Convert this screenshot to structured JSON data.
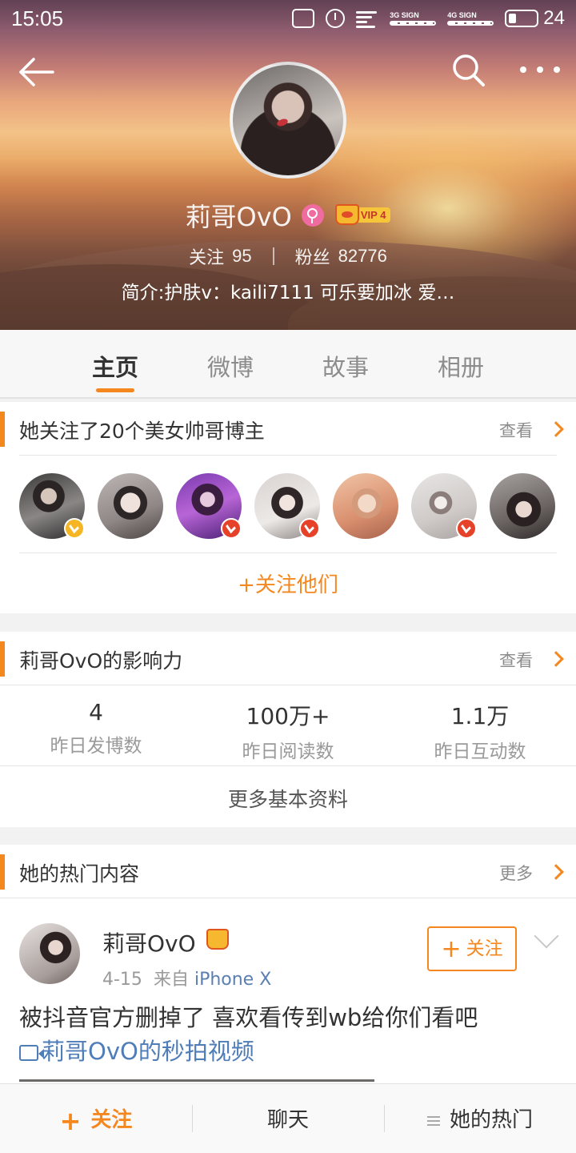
{
  "status_bar": {
    "time": "15:05",
    "network_1": "3G SIGN",
    "network_2": "4G SIGN",
    "battery": "24"
  },
  "profile": {
    "name": "莉哥OvO",
    "vip_level": "VIP 4",
    "following_label": "关注",
    "following_count": "95",
    "fans_label": "粉丝",
    "fans_count": "82776",
    "bio": "简介:护肤v：kaili7111  可乐要加冰  爱…"
  },
  "tabs": [
    {
      "label": "主页",
      "active": true
    },
    {
      "label": "微博",
      "active": false
    },
    {
      "label": "故事",
      "active": false
    },
    {
      "label": "相册",
      "active": false
    }
  ],
  "follows_card": {
    "title": "她关注了20个美女帅哥博主",
    "link": "查看",
    "action": "+关注他们",
    "avatars": [
      {
        "verified": "gold"
      },
      {
        "verified": "none"
      },
      {
        "verified": "red"
      },
      {
        "verified": "red"
      },
      {
        "verified": "none"
      },
      {
        "verified": "red"
      },
      {
        "verified": "none"
      }
    ]
  },
  "influence_card": {
    "title": "莉哥OvO的影响力",
    "link": "查看",
    "stats": [
      {
        "value": "4",
        "label": "昨日发博数"
      },
      {
        "value": "100万+",
        "label": "昨日阅读数"
      },
      {
        "value": "1.1万",
        "label": "昨日互动数"
      }
    ],
    "more": "更多基本资料"
  },
  "hot_card": {
    "title": "她的热门内容",
    "link": "更多",
    "post": {
      "author": "莉哥OvO",
      "date": "4-15",
      "from_label": "来自",
      "source": "iPhone X",
      "follow_label": "关注",
      "text": "被抖音官方删掉了  喜欢看传到wb给你们看吧",
      "video_link": "莉哥OvO的秒拍视频"
    }
  },
  "bottom_bar": {
    "follow": "关注",
    "chat": "聊天",
    "hot": "她的热门"
  },
  "colors": {
    "accent": "#f5871f",
    "link_blue": "#4f7db8",
    "gold_verified": "#f6b624",
    "red_verified": "#e6422a"
  }
}
